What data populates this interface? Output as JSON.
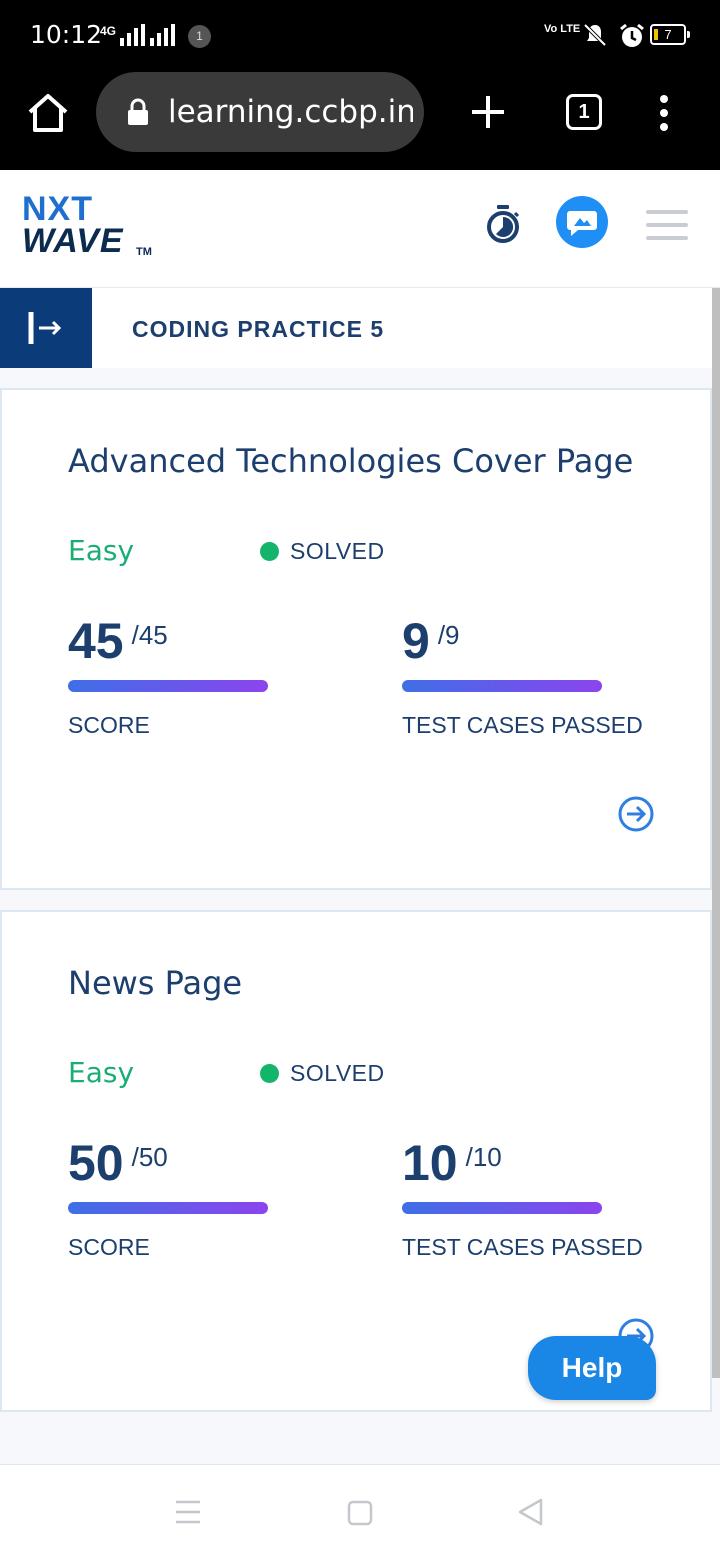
{
  "status_bar": {
    "time": "10:12",
    "network": "4G",
    "notification_count": "1",
    "volte": "Vo LTE",
    "battery": "7"
  },
  "browser": {
    "url": "learning.ccbp.in/",
    "tab_count": "1"
  },
  "header": {
    "logo_line1": "NXT",
    "logo_line2": "WAVE",
    "logo_tm": "TM"
  },
  "sub_header": {
    "title": "CODING PRACTICE 5"
  },
  "cards": [
    {
      "title": "Advanced Technologies Cover Page",
      "difficulty": "Easy",
      "status": "SOLVED",
      "score": "45",
      "score_total": "/45",
      "score_label": "SCORE",
      "tests": "9",
      "tests_total": "/9",
      "tests_label": "TEST CASES PASSED"
    },
    {
      "title": "News Page",
      "difficulty": "Easy",
      "status": "SOLVED",
      "score": "50",
      "score_total": "/50",
      "score_label": "SCORE",
      "tests": "10",
      "tests_total": "/10",
      "tests_label": "TEST CASES PASSED"
    }
  ],
  "help": {
    "label": "Help"
  },
  "colors": {
    "primary_navy": "#1d3f6e",
    "easy_green": "#1cad74",
    "solved_dot": "#14b56a",
    "help_blue": "#1a86e6",
    "bar_start": "#3f6fe6",
    "bar_end": "#8b44ee"
  }
}
